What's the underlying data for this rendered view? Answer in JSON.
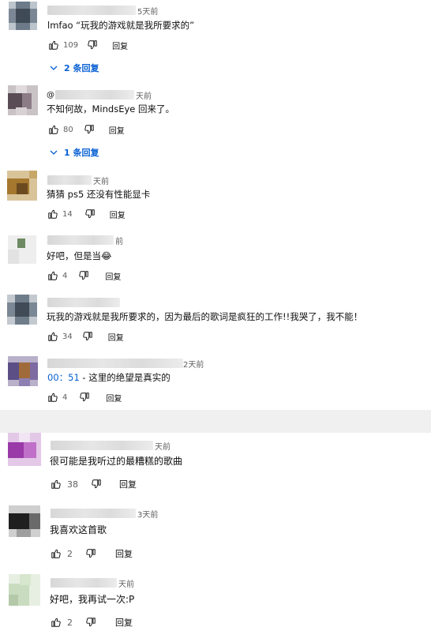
{
  "comments_top": [
    {
      "time": "5天前",
      "text": "lmfao “玩我的游戏就是我所要求的”",
      "likes": "109",
      "reply_label": "回复",
      "replies_label": "2 条回复"
    },
    {
      "time": "天前",
      "handle_prefix": "@",
      "text": "不知何故，MindsEye 回来了。",
      "likes": "80",
      "reply_label": "回复",
      "replies_label": "1 条回复"
    },
    {
      "time": "天前",
      "text": "猜猜 ps5 还没有性能显卡",
      "likes": "14",
      "reply_label": "回复"
    },
    {
      "time": "前",
      "text": "好吧，但是当😂",
      "likes": "4",
      "reply_label": "回复"
    },
    {
      "time": "",
      "text": "玩我的游戏就是我所要求的，因为最后的歌词是疯狂的工作!!我哭了，我不能！",
      "likes": "34",
      "reply_label": "回复"
    },
    {
      "time": "2天前",
      "timestamp": "00：51",
      "text": " - 这里的绝望是真实的",
      "likes": "4",
      "reply_label": "回复"
    }
  ],
  "comments_bottom": [
    {
      "time": "天前",
      "text": "很可能是我听过的最糟糕的歌曲",
      "likes": "38",
      "reply_label": "回复"
    },
    {
      "time": "3天前",
      "text": "我喜欢这首歌",
      "likes": "2",
      "reply_label": "回复"
    },
    {
      "time": "天前",
      "text": "好吧，我再试一次:P",
      "likes": "2",
      "reply_label": "回复"
    }
  ],
  "icons": {
    "like": "thumb-up-icon",
    "dislike": "thumb-down-icon",
    "expand": "chevron-down-icon"
  },
  "colors": {
    "link": "#065fd4",
    "divider": "#f0f0f0",
    "meta": "#606060"
  }
}
